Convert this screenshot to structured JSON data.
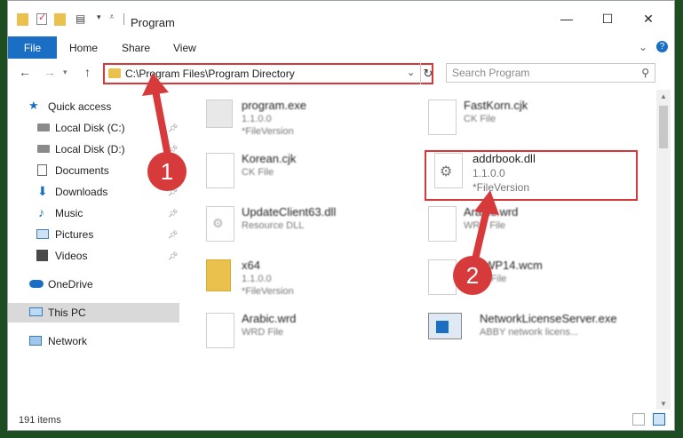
{
  "window": {
    "title": "Program",
    "controls": {
      "minimize": "—",
      "maximize": "☐",
      "close": "✕"
    }
  },
  "ribbon": {
    "tabs": [
      "File",
      "Home",
      "Share",
      "View"
    ],
    "expand_glyph": "⌄",
    "help_glyph": "?"
  },
  "address": {
    "path": "C:\\Program Files\\Program Directory",
    "dropdown_glyph": "⌄",
    "refresh_glyph": "↻"
  },
  "search": {
    "placeholder": "Search Program",
    "icon": "search-icon"
  },
  "sidebar": {
    "items": [
      {
        "label": "Quick access",
        "icon": "star-icon",
        "pinned": false
      },
      {
        "label": "Local Disk (C:)",
        "icon": "drive-icon",
        "pinned": true
      },
      {
        "label": "Local Disk (D:)",
        "icon": "drive-icon",
        "pinned": true
      },
      {
        "label": "Documents",
        "icon": "documents-icon",
        "pinned": true
      },
      {
        "label": "Downloads",
        "icon": "download-icon",
        "pinned": true
      },
      {
        "label": "Music",
        "icon": "music-icon",
        "pinned": true
      },
      {
        "label": "Pictures",
        "icon": "pictures-icon",
        "pinned": true
      },
      {
        "label": "Videos",
        "icon": "videos-icon",
        "pinned": true
      },
      {
        "label": "OneDrive",
        "icon": "cloud-icon",
        "pinned": false
      },
      {
        "label": "This PC",
        "icon": "computer-icon",
        "pinned": false,
        "selected": true
      },
      {
        "label": "Network",
        "icon": "network-icon",
        "pinned": false
      }
    ]
  },
  "files": [
    {
      "name": "program.exe",
      "line2": "1.1.0.0",
      "line3": "*FileVersion",
      "icon": "exe-icon"
    },
    {
      "name": "FastKorn.cjk",
      "line2": "CK File",
      "line3": "",
      "icon": "file-icon"
    },
    {
      "name": "Korean.cjk",
      "line2": "CK File",
      "line3": "",
      "icon": "file-icon"
    },
    {
      "name": "addrbook.dll",
      "line2": "1.1.0.0",
      "line3": "*FileVersion",
      "icon": "dll-gear-icon",
      "highlighted": true
    },
    {
      "name": "UpdateClient63.dll",
      "line2": "Resource DLL",
      "line3": "",
      "icon": "dll-gear-icon"
    },
    {
      "name": "Arabic.wrd",
      "line2": "WRD File",
      "line3": "",
      "icon": "file-icon"
    },
    {
      "name": "x64",
      "line2": "1.1.0.0",
      "line3": "*FileVersion",
      "icon": "folder-icon"
    },
    {
      "name": "WtoWP14.wcm",
      "line2": "WCM File",
      "line3": "",
      "icon": "file-icon"
    },
    {
      "name": "Arabic.wrd",
      "line2": "WRD File",
      "line3": "",
      "icon": "file-icon"
    },
    {
      "name": "NetworkLicenseServer.exe",
      "line2": "ABBY network licens...",
      "line3": "",
      "icon": "app-window-icon"
    }
  ],
  "status": {
    "count": "191 items"
  },
  "callouts": [
    "1",
    "2"
  ],
  "colors": {
    "accent": "#1a6fc4",
    "annotation_red": "#d9383a",
    "folder": "#e9c14c"
  }
}
